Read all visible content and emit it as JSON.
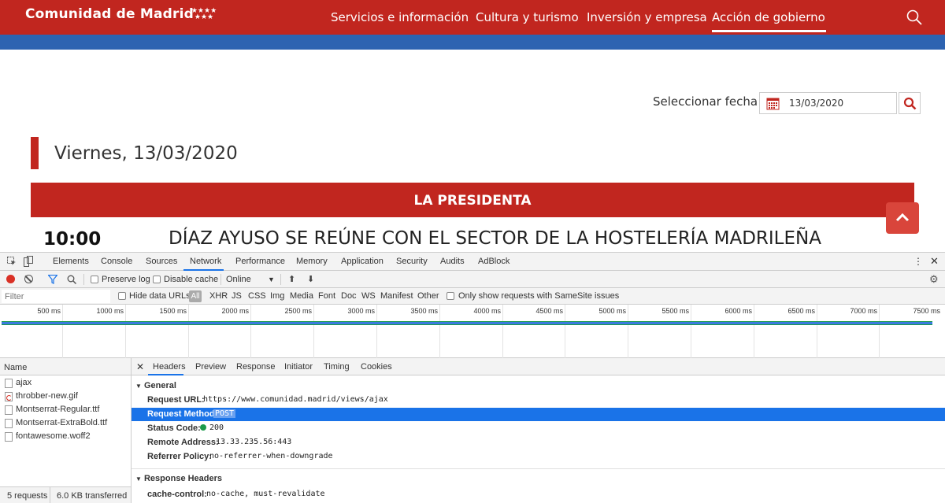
{
  "site": {
    "logo_text": "Comunidad de Madrid",
    "nav": [
      "Servicios e información",
      "Cultura y turismo",
      "Inversión y empresa",
      "Acción de gobierno"
    ],
    "date_label": "Seleccionar fecha",
    "date_value": "13/03/2020",
    "day_title": "Viernes, 13/03/2020",
    "section_band": "LA PRESIDENTA",
    "event_time": "10:00",
    "event_headline": "DÍAZ AYUSO SE REÚNE CON EL SECTOR DE LA HOSTELERÍA MADRILEÑA",
    "colors": {
      "brand_red": "#c1261f",
      "brand_blue": "#2d63b1"
    }
  },
  "devtools": {
    "tabs": [
      "Elements",
      "Console",
      "Sources",
      "Network",
      "Performance",
      "Memory",
      "Application",
      "Security",
      "Audits",
      "AdBlock"
    ],
    "active_tab": "Network",
    "toolbar": {
      "preserve_log": "Preserve log",
      "disable_cache": "Disable cache",
      "throttling": "Online"
    },
    "filter": {
      "placeholder": "Filter",
      "hide_data_urls": "Hide data URLs",
      "all": "All",
      "types": [
        "XHR",
        "JS",
        "CSS",
        "Img",
        "Media",
        "Font",
        "Doc",
        "WS",
        "Manifest",
        "Other"
      ],
      "samesite": "Only show requests with SameSite issues"
    },
    "timeline_ticks": [
      "500 ms",
      "1000 ms",
      "1500 ms",
      "2000 ms",
      "2500 ms",
      "3000 ms",
      "3500 ms",
      "4000 ms",
      "4500 ms",
      "5000 ms",
      "5500 ms",
      "6000 ms",
      "6500 ms",
      "7000 ms",
      "7500 ms"
    ],
    "requests": {
      "header": "Name",
      "items": [
        "ajax",
        "throbber-new.gif",
        "Montserrat-Regular.ttf",
        "Montserrat-ExtraBold.ttf",
        "fontawesome.woff2"
      ],
      "summary_requests": "5 requests",
      "summary_transferred": "6.0 KB transferred"
    },
    "details": {
      "tabs": [
        "Headers",
        "Preview",
        "Response",
        "Initiator",
        "Timing",
        "Cookies"
      ],
      "general_title": "General",
      "general": [
        {
          "key": "Request URL:",
          "value": "https://www.comunidad.madrid/views/ajax"
        },
        {
          "key": "Request Method:",
          "value": "POST"
        },
        {
          "key": "Status Code:",
          "value": "200"
        },
        {
          "key": "Remote Address:",
          "value": "13.33.235.56:443"
        },
        {
          "key": "Referrer Policy:",
          "value": "no-referrer-when-downgrade"
        }
      ],
      "response_title": "Response Headers",
      "response": [
        {
          "key": "cache-control:",
          "value": "no-cache, must-revalidate"
        }
      ]
    }
  }
}
